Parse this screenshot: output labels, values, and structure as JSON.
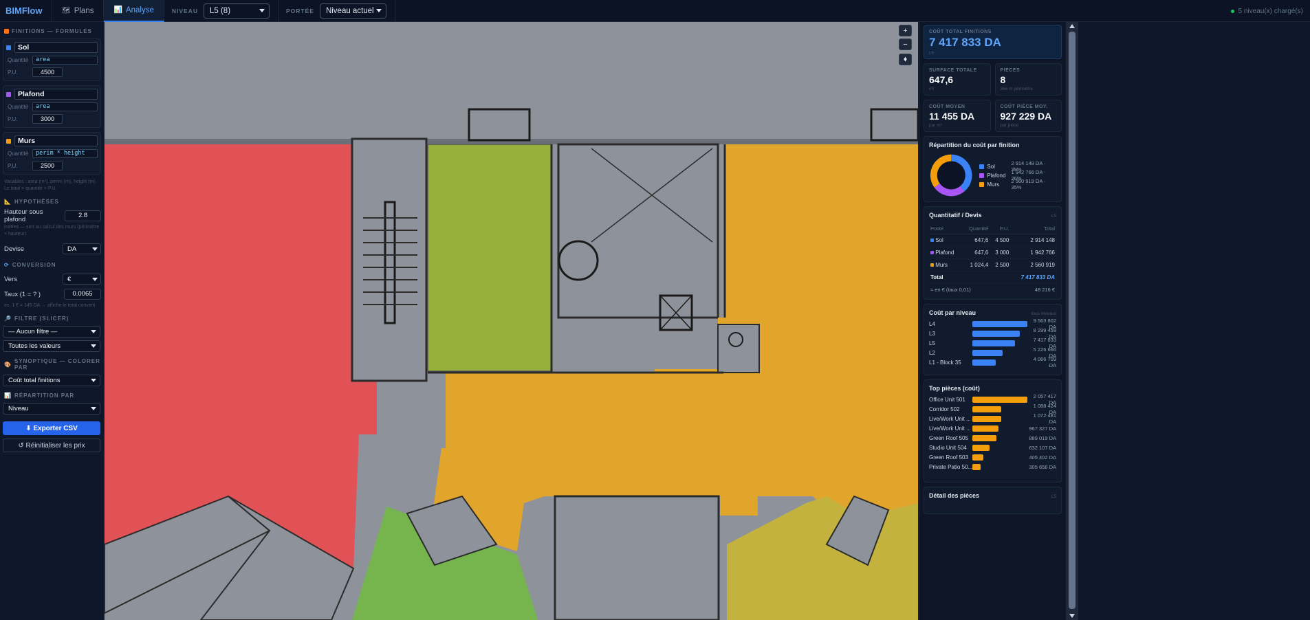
{
  "app": {
    "brand": "BIMFlow"
  },
  "tabs": [
    {
      "label": "Plans",
      "icon": "map-icon"
    },
    {
      "label": "Analyse",
      "icon": "chart-icon"
    }
  ],
  "toolbar": {
    "niveau_label": "NIVEAU",
    "niveau_value": "L5 (8)",
    "portee_label": "PORTÉE",
    "portee_value": "Niveau actuel",
    "status": "5 niveau(x) chargé(s)"
  },
  "sidebar": {
    "finitions_title": "FINITIONS — FORMULES",
    "finitions": [
      {
        "name": "Sol",
        "qty_label": "Quantité",
        "formula": "area",
        "pu_label": "P.U.",
        "pu": "4500",
        "color": "#3b82f6"
      },
      {
        "name": "Plafond",
        "qty_label": "Quantité",
        "formula": "area",
        "pu_label": "P.U.",
        "pu": "3000",
        "color": "#a855f7"
      },
      {
        "name": "Murs",
        "qty_label": "Quantité",
        "formula": "perim * height",
        "pu_label": "P.U.",
        "pu": "2500",
        "color": "#f59e0b"
      }
    ],
    "variables_hint": "Variables : area (m²), perim (m), height (m). Le total = quantité × P.U.",
    "hypotheses_title": "HYPOTHÈSES",
    "hauteur_label": "Hauteur sous plafond",
    "hauteur_value": "2.8",
    "hauteur_hint": "mètres — sert au calcul des murs (périmètre × hauteur)",
    "devise_label": "Devise",
    "devise_value": "DA",
    "conversion_title": "CONVERSION",
    "vers_label": "Vers",
    "vers_value": "€",
    "taux_label": "Taux (1 = ? )",
    "taux_value": "0.0065",
    "taux_hint": "ex. 1 € = 145 DA → affiche le total converti",
    "filtre_title": "FILTRE (SLICER)",
    "filtre_value": "— Aucun filtre —",
    "filtre_values": "Toutes les valeurs",
    "synoptique_title": "SYNOPTIQUE — COLORER PAR",
    "synoptique_value": "Coût total finitions",
    "repartition_title": "RÉPARTITION PAR",
    "repartition_value": "Niveau",
    "export_label": "⬇ Exporter CSV",
    "reset_label": "↺ Réinitialiser les prix"
  },
  "kpis": {
    "total": {
      "label": "COÛT TOTAL FINITIONS",
      "value": "7 417 833 DA",
      "sub": "L5"
    },
    "surface": {
      "label": "SURFACE TOTALE",
      "value": "647,6",
      "sub": "m²"
    },
    "pieces": {
      "label": "PIÈCES",
      "value": "8",
      "sub": "366 m périmètre"
    },
    "cout_moyen": {
      "label": "COÛT MOYEN",
      "value": "11 455 DA",
      "sub": "par m²"
    },
    "cout_piece": {
      "label": "COÛT PIÈCE MOY.",
      "value": "927 229 DA",
      "sub": "par pièce"
    }
  },
  "repartition": {
    "title": "Répartition du coût par finition",
    "items": [
      {
        "name": "Sol",
        "value": "2 914 148 DA · 39%",
        "pct": 39,
        "color": "#3b82f6"
      },
      {
        "name": "Plafond",
        "value": "1 942 766 DA · 26%",
        "pct": 26,
        "color": "#a855f7"
      },
      {
        "name": "Murs",
        "value": "2 560 919 DA · 35%",
        "pct": 35,
        "color": "#f59e0b"
      }
    ]
  },
  "devis": {
    "title": "Quantitatif / Devis",
    "aside": "L5",
    "headers": [
      "Poste",
      "Quantité",
      "P.U.",
      "Total"
    ],
    "rows": [
      {
        "poste": "Sol",
        "qty": "647,6",
        "pu": "4 500",
        "total": "2 914 148",
        "color": "#3b82f6"
      },
      {
        "poste": "Plafond",
        "qty": "647,6",
        "pu": "3 000",
        "total": "1 942 766",
        "color": "#a855f7"
      },
      {
        "poste": "Murs",
        "qty": "1 024,4",
        "pu": "2 500",
        "total": "2 560 919",
        "color": "#f59e0b"
      }
    ],
    "total_label": "Total",
    "total_value": "7 417 833 DA",
    "conv_label": "≈ en € (taux 0,01)",
    "conv_value": "48 216 €"
  },
  "cout_niveau": {
    "title": "Coût par niveau",
    "aside": "tous niveaux",
    "rows": [
      {
        "label": "L4",
        "value": "9 563 802 DA",
        "amount": 9563802
      },
      {
        "label": "L3",
        "value": "8 299 459 DA",
        "amount": 8299459
      },
      {
        "label": "L5",
        "value": "7 417 833 DA",
        "amount": 7417833
      },
      {
        "label": "L2",
        "value": "5 226 666 DA",
        "amount": 5226666
      },
      {
        "label": "L1 - Block 35",
        "value": "4 066 709 DA",
        "amount": 4066709
      }
    ]
  },
  "top_pieces": {
    "title": "Top pièces (coût)",
    "rows": [
      {
        "label": "Office Unit 501",
        "value": "2 057 417 DA",
        "amount": 2057417
      },
      {
        "label": "Corridor 502",
        "value": "1 088 424 DA",
        "amount": 1088424
      },
      {
        "label": "Live/Work Unit ...",
        "value": "1 072 481 DA",
        "amount": 1072481
      },
      {
        "label": "Live/Work Unit ...",
        "value": "967 327 DA",
        "amount": 967327
      },
      {
        "label": "Green Roof 505",
        "value": "889 019 DA",
        "amount": 889019
      },
      {
        "label": "Studio Unit 504",
        "value": "632 107 DA",
        "amount": 632107
      },
      {
        "label": "Green Roof 503",
        "value": "405 402 DA",
        "amount": 405402
      },
      {
        "label": "Private Patio 50...",
        "value": "305 656 DA",
        "amount": 305656
      }
    ]
  },
  "detail": {
    "title": "Détail des pièces",
    "aside": "L5"
  },
  "map": {
    "zoom_in": "+",
    "zoom_out": "−",
    "reset": "⬧"
  },
  "colors": {
    "accent": "#3b82f6",
    "room_red": "#e05256",
    "room_olive": "#97b03c",
    "room_orange": "#e0a52a",
    "room_green": "#76b44e",
    "room_yellow": "#c4b23e"
  }
}
